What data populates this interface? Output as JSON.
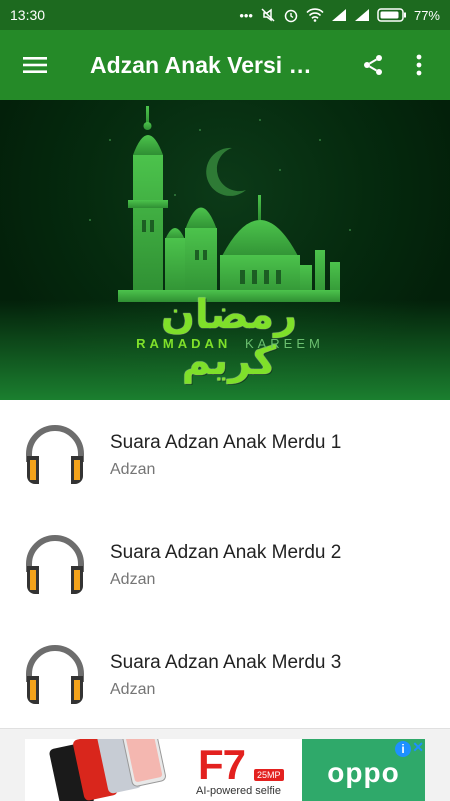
{
  "status_bar": {
    "time": "13:30",
    "battery_percent": "77%"
  },
  "app_bar": {
    "title": "Adzan Anak Versi Baru"
  },
  "banner": {
    "arabic_text": "رمضان كريم",
    "caption_left": "RAMADAN",
    "caption_right": "KAREEM"
  },
  "list": [
    {
      "title": "Suara Adzan Anak Merdu 1",
      "subtitle": "Adzan"
    },
    {
      "title": "Suara Adzan Anak Merdu 2",
      "subtitle": "Adzan"
    },
    {
      "title": "Suara Adzan Anak Merdu 3",
      "subtitle": "Adzan"
    }
  ],
  "ad": {
    "model": "F7",
    "megapixels": "25MP",
    "tagline": "AI-powered selfie",
    "brand": "oppo"
  },
  "colors": {
    "status_bar": "#1d6a1f",
    "app_bar": "#258a28",
    "banner_dark": "#052a0e",
    "mosque_green": "#3cb043",
    "ad_green": "#2fa96a"
  }
}
